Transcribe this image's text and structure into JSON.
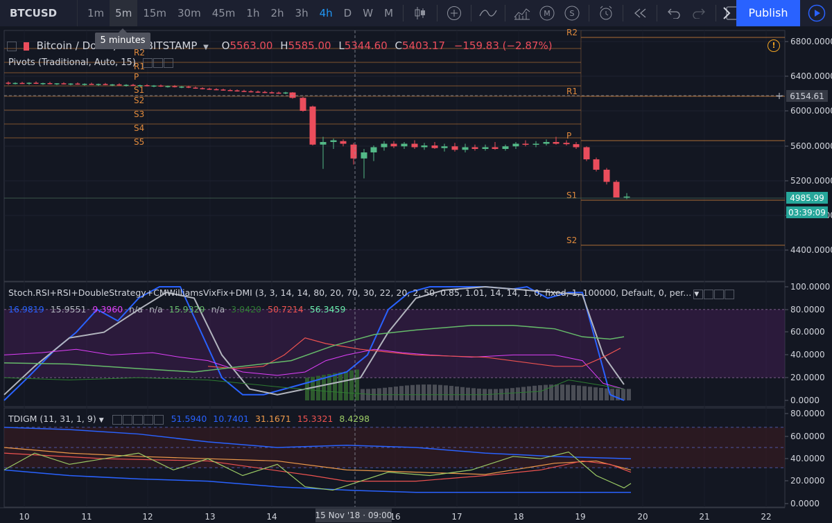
{
  "toolbar": {
    "symbol": "BTCUSD",
    "intervals": [
      "1m",
      "5m",
      "15m",
      "30m",
      "45m",
      "1h",
      "2h",
      "3h",
      "4h",
      "D",
      "W",
      "M"
    ],
    "active_interval": "4h",
    "hover_interval": "5m",
    "tooltip": "5 minutes",
    "publish_label": "Publish"
  },
  "main_legend": {
    "title": "Bitcoin / Dollar, 240, BITSTAMP",
    "o_label": "O",
    "o_value": "5563.00",
    "h_label": "H",
    "h_value": "5585.00",
    "l_label": "L",
    "l_value": "5344.60",
    "c_label": "C",
    "c_value": "5403.17",
    "change": "−159.83 (−2.87%)",
    "pivots": "Pivots (Traditional, Auto, 15)",
    "alert": "!"
  },
  "price_axis": {
    "ticks": [
      "6800.0000",
      "6400.0000",
      "6000.0000",
      "5600.0000",
      "5200.0000",
      "4800.0000",
      "4400.0000"
    ],
    "crosshair_price": "6154.61",
    "last_price": "4985.99",
    "countdown": "03:39:09"
  },
  "pivot_labels_left": [
    "R2",
    "R1",
    "P",
    "S1",
    "S2",
    "S3",
    "S4",
    "S5"
  ],
  "pivot_labels_right": [
    "R2",
    "R1",
    "P",
    "S1",
    "S2"
  ],
  "stoch_pane": {
    "legend": "Stoch.RSI+RSI+DoubleStrategy+CMWilliamsVixFix+DMI (3, 3, 14, 14, 80, 20, 70, 30, 22, 20, 2, 50, 0.85, 1.01, 14, 14, 1, 0, fixed, 1, 100000, Default, 0, per...",
    "values": [
      {
        "text": "16.9819",
        "color": "#2962ff"
      },
      {
        "text": "15.9551",
        "color": "#b2b5be"
      },
      {
        "text": "9.3960",
        "color": "#e040fb"
      },
      {
        "text": "n/a",
        "color": "#b2b5be"
      },
      {
        "text": "n/a",
        "color": "#b2b5be"
      },
      {
        "text": "15.9329",
        "color": "#66bb6a"
      },
      {
        "text": "n/a",
        "color": "#b2b5be"
      },
      {
        "text": "3.0420",
        "color": "#2e7d32"
      },
      {
        "text": "50.7214",
        "color": "#ef5350"
      },
      {
        "text": "56.3459",
        "color": "#69f0ae"
      }
    ],
    "ticks": [
      "100.0000",
      "80.0000",
      "60.0000",
      "40.0000",
      "20.0000",
      "0.0000"
    ]
  },
  "tdigm_pane": {
    "legend": "TDIGM (11, 31, 1, 9)",
    "values": [
      {
        "text": "51.5940",
        "color": "#2962ff"
      },
      {
        "text": "10.7401",
        "color": "#2962ff"
      },
      {
        "text": "31.1671",
        "color": "#ef9a4a"
      },
      {
        "text": "15.3321",
        "color": "#ef5350"
      },
      {
        "text": "8.4298",
        "color": "#9ccc65"
      }
    ],
    "ticks": [
      "80.0000",
      "60.0000",
      "40.0000",
      "20.0000",
      "0.0000"
    ]
  },
  "time_axis": {
    "labels": [
      "10",
      "11",
      "12",
      "13",
      "14",
      "16",
      "17",
      "18",
      "19",
      "20",
      "21",
      "22"
    ],
    "crosshair_time": "15 Nov '18 · 09:00"
  },
  "colors": {
    "background": "#131722",
    "up": "#53b987",
    "down": "#eb4d5c",
    "pivot": "#e08a3c",
    "accent": "#2962ff"
  }
}
